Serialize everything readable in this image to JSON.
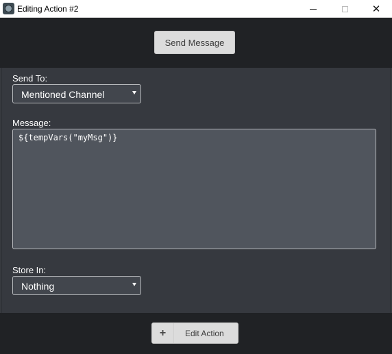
{
  "window": {
    "title": "Editing Action #2",
    "app_icon": "gear-bot-icon",
    "minimize_icon": "minimize-icon",
    "maximize_icon": "maximize-icon",
    "close_icon": "close-icon",
    "close_glyph": "✕"
  },
  "header": {
    "action_button_label": "Send Message"
  },
  "form": {
    "send_to": {
      "label": "Send To:",
      "value": "Mentioned Channel"
    },
    "message": {
      "label": "Message:",
      "value": "${tempVars(\"myMsg\")}"
    },
    "store_in": {
      "label": "Store In:",
      "value": "Nothing"
    }
  },
  "footer": {
    "plus_glyph": "+",
    "edit_action_label": "Edit Action"
  },
  "colors": {
    "background": "#202225",
    "panel": "#36393f",
    "input_bg": "#50555d",
    "button_bg": "#dcdcdc"
  }
}
